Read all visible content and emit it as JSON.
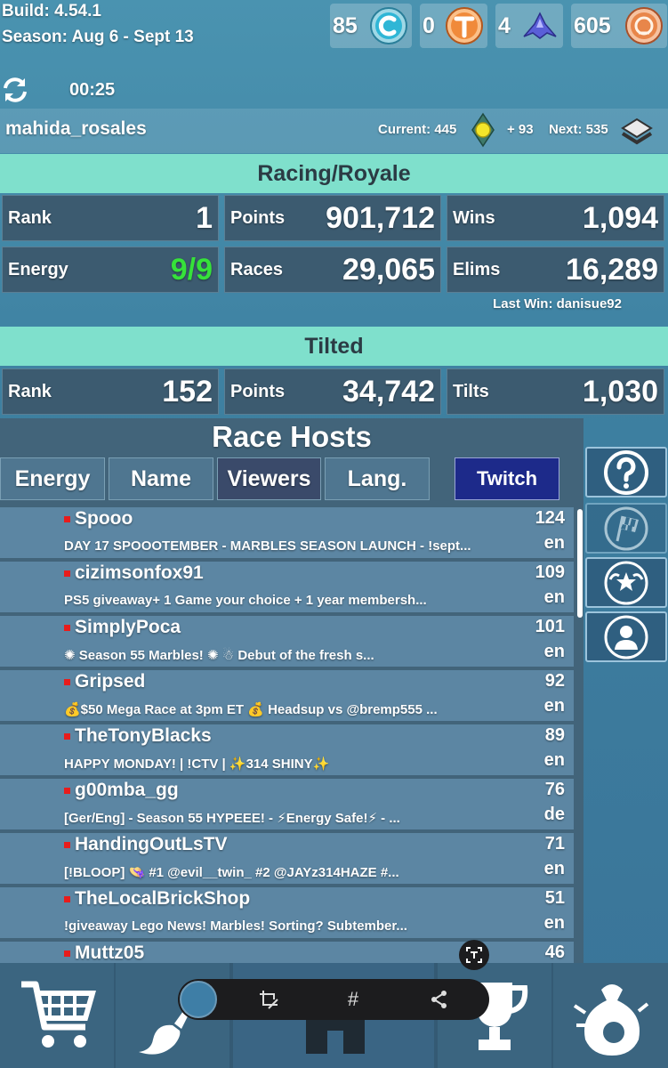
{
  "header": {
    "build": "Build: 4.54.1",
    "season": "Season: Aug 6 - Sept 13",
    "timer": "00:25",
    "currencies": [
      {
        "value": "85",
        "icon": "c-coin-icon",
        "color": "#2fb6d6"
      },
      {
        "value": "0",
        "icon": "t-coin-icon",
        "color": "#f08a3a"
      },
      {
        "value": "4",
        "icon": "ship-icon",
        "color": "#5a5fd8"
      },
      {
        "value": "605",
        "icon": "marble-coin-icon",
        "color": "#e8864a"
      }
    ]
  },
  "user": {
    "name": "mahida_rosales",
    "current": "Current: 445",
    "gain": "+ 93",
    "next": "Next: 535"
  },
  "racing": {
    "title": "Racing/Royale",
    "rank_label": "Rank",
    "rank": "1",
    "points_label": "Points",
    "points": "901,712",
    "wins_label": "Wins",
    "wins": "1,094",
    "energy_label": "Energy",
    "energy": "9/9",
    "races_label": "Races",
    "races": "29,065",
    "elims_label": "Elims",
    "elims": "16,289",
    "last_win": "Last Win: danisue92"
  },
  "tilted": {
    "title": "Tilted",
    "rank_label": "Rank",
    "rank": "152",
    "points_label": "Points",
    "points": "34,742",
    "tilts_label": "Tilts",
    "tilts": "1,030"
  },
  "hosts": {
    "title": "Race Hosts",
    "sort": {
      "energy": "Energy",
      "name": "Name",
      "viewers": "Viewers",
      "lang": "Lang.",
      "twitch": "Twitch"
    },
    "list": [
      {
        "name": "Spooo",
        "viewers": "124",
        "desc": "DAY 17 SPOOOTEMBER - MARBLES SEASON LAUNCH - !sept...",
        "lang": "en"
      },
      {
        "name": "cizimsonfox91",
        "viewers": "109",
        "desc": "PS5 giveaway+ 1 Game your choice + 1 year membersh...",
        "lang": "en"
      },
      {
        "name": "SimplyPoca",
        "viewers": "101",
        "desc": "✺ Season 55 Marbles! ✺ ☃ Debut of the fresh s...",
        "lang": "en"
      },
      {
        "name": "Gripsed",
        "viewers": "92",
        "desc": "💰$50 Mega Race at 3pm ET 💰 Headsup vs @bremp555 ...",
        "lang": "en"
      },
      {
        "name": "TheTonyBlacks",
        "viewers": "89",
        "desc": "HAPPY MONDAY! | !CTV | ✨314 SHINY✨",
        "lang": "en"
      },
      {
        "name": "g00mba_gg",
        "viewers": "76",
        "desc": "[Ger/Eng] - Season 55 HYPEEE! - ⚡Energy Safe!⚡ - ...",
        "lang": "de"
      },
      {
        "name": "HandingOutLsTV",
        "viewers": "71",
        "desc": "[!BLOOP] 👒 #1 @evil__twin_ #2 @JAYz314HAZE #...",
        "lang": "en"
      },
      {
        "name": "TheLocalBrickShop",
        "viewers": "51",
        "desc": "!giveaway Lego News! Marbles! Sorting? Subtember...",
        "lang": "en"
      },
      {
        "name": "Muttz05",
        "viewers": "46",
        "desc": "",
        "lang": ""
      }
    ]
  },
  "toolbar": {
    "hash": "#"
  },
  "colors": {
    "section_head": "#7fe0cc",
    "energy_green": "#36e23a",
    "twitch_blue": "#1d2a8a",
    "live_dot": "#e81c1c"
  }
}
